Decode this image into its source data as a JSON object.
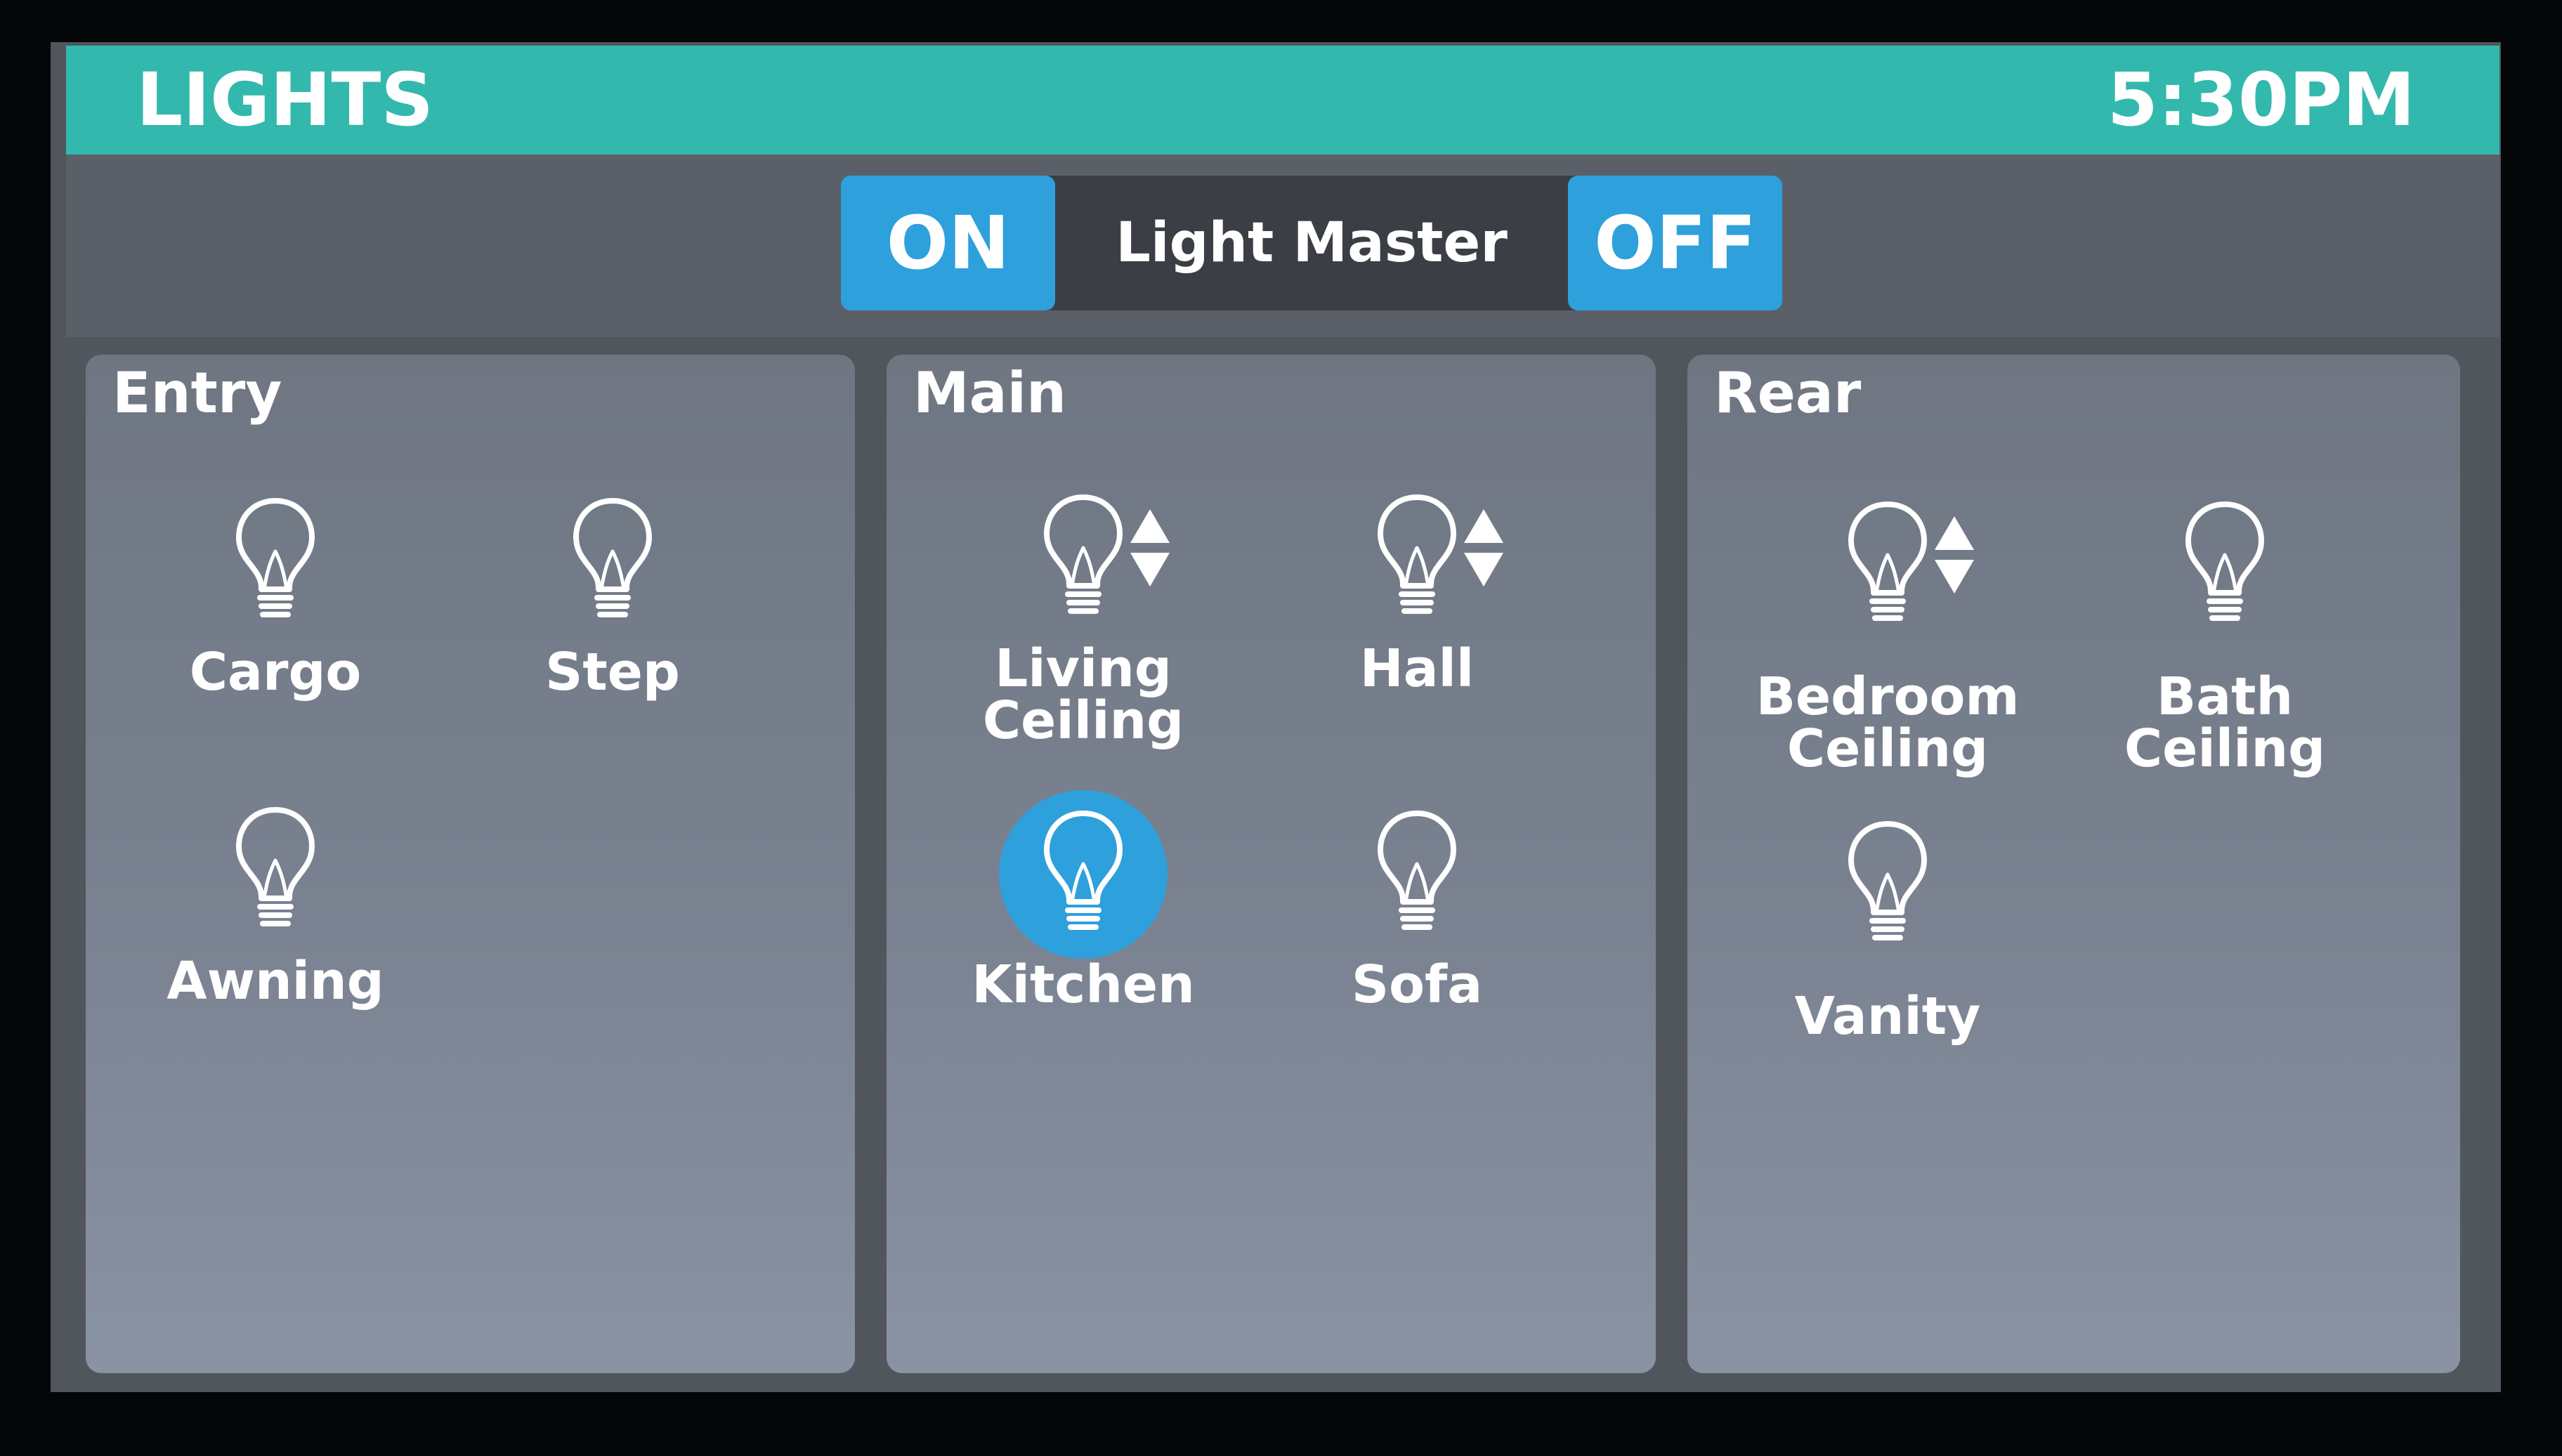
{
  "header": {
    "title": "LIGHTS",
    "time": "5:30PM"
  },
  "master": {
    "on_label": "ON",
    "label": "Light Master",
    "off_label": "OFF"
  },
  "colors": {
    "header_bg": "#33b8ad",
    "accent_blue": "#2ea0dc"
  },
  "panels": {
    "entry": {
      "title": "Entry",
      "lights": [
        {
          "label": "Cargo",
          "dimmable": false,
          "active": false,
          "icon": "lightbulb-icon"
        },
        {
          "label": "Step",
          "dimmable": false,
          "active": false,
          "icon": "lightbulb-icon"
        },
        {
          "label": "Awning",
          "dimmable": false,
          "active": false,
          "icon": "lightbulb-icon"
        }
      ]
    },
    "main": {
      "title": "Main",
      "lights": [
        {
          "label": "Living\nCeiling",
          "dimmable": true,
          "active": false,
          "icon": "lightbulb-icon"
        },
        {
          "label": "Hall",
          "dimmable": true,
          "active": false,
          "icon": "lightbulb-icon"
        },
        {
          "label": "Kitchen",
          "dimmable": false,
          "active": true,
          "icon": "lightbulb-icon"
        },
        {
          "label": "Sofa",
          "dimmable": false,
          "active": false,
          "icon": "lightbulb-icon"
        }
      ]
    },
    "rear": {
      "title": "Rear",
      "lights": [
        {
          "label": "Bedroom\nCeiling",
          "dimmable": true,
          "active": false,
          "icon": "lightbulb-icon"
        },
        {
          "label": "Bath\nCeiling",
          "dimmable": false,
          "active": false,
          "icon": "lightbulb-icon"
        },
        {
          "label": "Vanity",
          "dimmable": false,
          "active": false,
          "icon": "lightbulb-icon"
        }
      ]
    }
  }
}
